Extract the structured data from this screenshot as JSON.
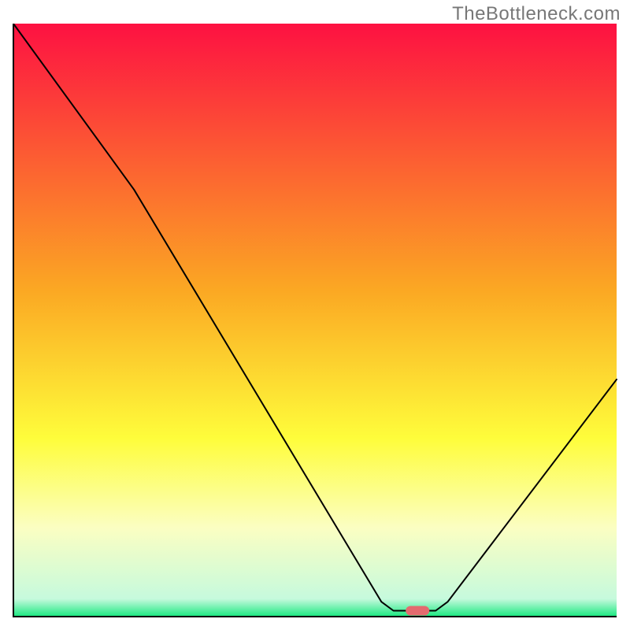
{
  "watermark": "TheBottleneck.com",
  "chart_data": {
    "type": "line",
    "title": "",
    "xlabel": "",
    "ylabel": "",
    "ylim": [
      0,
      100
    ],
    "xlim": [
      0,
      100
    ],
    "curve": [
      {
        "x": 0,
        "y": 100
      },
      {
        "x": 20,
        "y": 72
      },
      {
        "x": 61,
        "y": 2.5
      },
      {
        "x": 63,
        "y": 1
      },
      {
        "x": 70,
        "y": 1
      },
      {
        "x": 72,
        "y": 2.5
      },
      {
        "x": 100,
        "y": 40
      }
    ],
    "marker": {
      "x": 67,
      "y": 1
    },
    "gradient_stops": [
      {
        "offset": 0.0,
        "color": "#fd1142"
      },
      {
        "offset": 0.45,
        "color": "#fba823"
      },
      {
        "offset": 0.7,
        "color": "#fefd3b"
      },
      {
        "offset": 0.85,
        "color": "#fbfec2"
      },
      {
        "offset": 0.97,
        "color": "#c6fadd"
      },
      {
        "offset": 1.0,
        "color": "#19e880"
      }
    ]
  }
}
